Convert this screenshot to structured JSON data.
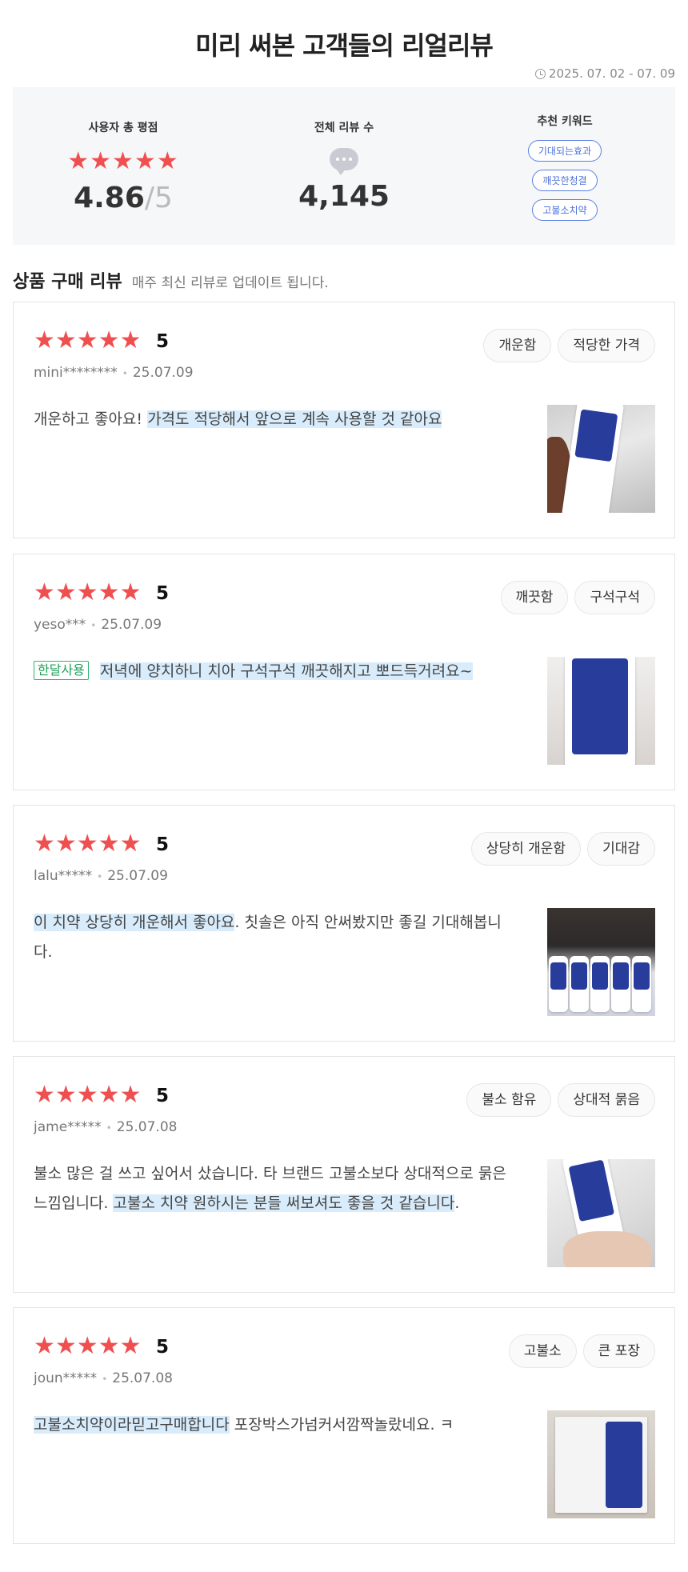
{
  "header": {
    "title": "미리 써본 고객들의 리얼리뷰",
    "period": "2025. 07. 02 - 07. 09"
  },
  "summary": {
    "rating_label": "사용자 총 평점",
    "rating_value": "4.86",
    "rating_separator": "/",
    "rating_max": "5",
    "rating_stars": "★★★★★",
    "count_label": "전체 리뷰 수",
    "count_value": "4,145",
    "keywords_label": "추천 키워드",
    "keywords": [
      "기대되는효과",
      "깨끗한청결",
      "고불소치약"
    ]
  },
  "section": {
    "title": "상품 구매 리뷰",
    "subtitle": "매주 최신 리뷰로 업데이트 됩니다."
  },
  "reviews": [
    {
      "stars": "★★★★★",
      "score": "5",
      "user": "mini********",
      "date": "25.07.09",
      "tags": [
        "개운함",
        "적당한 가격"
      ],
      "badge": "",
      "text_plain": "개운하고 좋아요! ",
      "text_highlight": "가격도 적당해서 앞으로 계속 사용할 것 같아요",
      "text_after": "",
      "photo": "dr-clinic-toothpaste-in-hand"
    },
    {
      "stars": "★★★★★",
      "score": "5",
      "user": "yeso***",
      "date": "25.07.09",
      "tags": [
        "깨끗함",
        "구석구석"
      ],
      "badge": "한달사용",
      "text_plain": "",
      "text_highlight": "저녁에 양치하니 치아 구석구석 깨끗해지고 뽀드득거려요~",
      "text_after": "",
      "photo": "toothpaste-tube-closeup"
    },
    {
      "stars": "★★★★★",
      "score": "5",
      "user": "lalu*****",
      "date": "25.07.09",
      "tags": [
        "상당히 개운함",
        "기대감"
      ],
      "badge": "",
      "text_plain": "",
      "text_highlight": "이 치약 상당히 개운해서 좋아요",
      "text_after": ". 칫솔은 아직 안써봤지만 좋길 기대해봅니다.",
      "photo": "toothpaste-boxes-row"
    },
    {
      "stars": "★★★★★",
      "score": "5",
      "user": "jame*****",
      "date": "25.07.08",
      "tags": [
        "불소 함유",
        "상대적 묽음"
      ],
      "badge": "",
      "text_plain": "불소 많은 걸 쓰고 싶어서 샀습니다. 타 브랜드 고불소보다 상대적으로 묽은 느낌입니다. ",
      "text_highlight": "고불소 치약 원하시는 분들 써보셔도 좋을 것 같습니다",
      "text_after": ".",
      "photo": "toothpaste-in-hand"
    },
    {
      "stars": "★★★★★",
      "score": "5",
      "user": "joun*****",
      "date": "25.07.08",
      "tags": [
        "고불소",
        "큰 포장"
      ],
      "badge": "",
      "text_plain": "",
      "text_highlight": "고불소치약이라믿고구매합니다",
      "text_after": " 포장박스가넘커서깜짝놀랐네요. ㅋ",
      "photo": "toothpaste-package-box"
    }
  ],
  "colors": {
    "star": "#ef4f4f",
    "highlight": "#d8ecfb",
    "keyword": "#4a6fd8",
    "badge": "#1f9e58"
  }
}
